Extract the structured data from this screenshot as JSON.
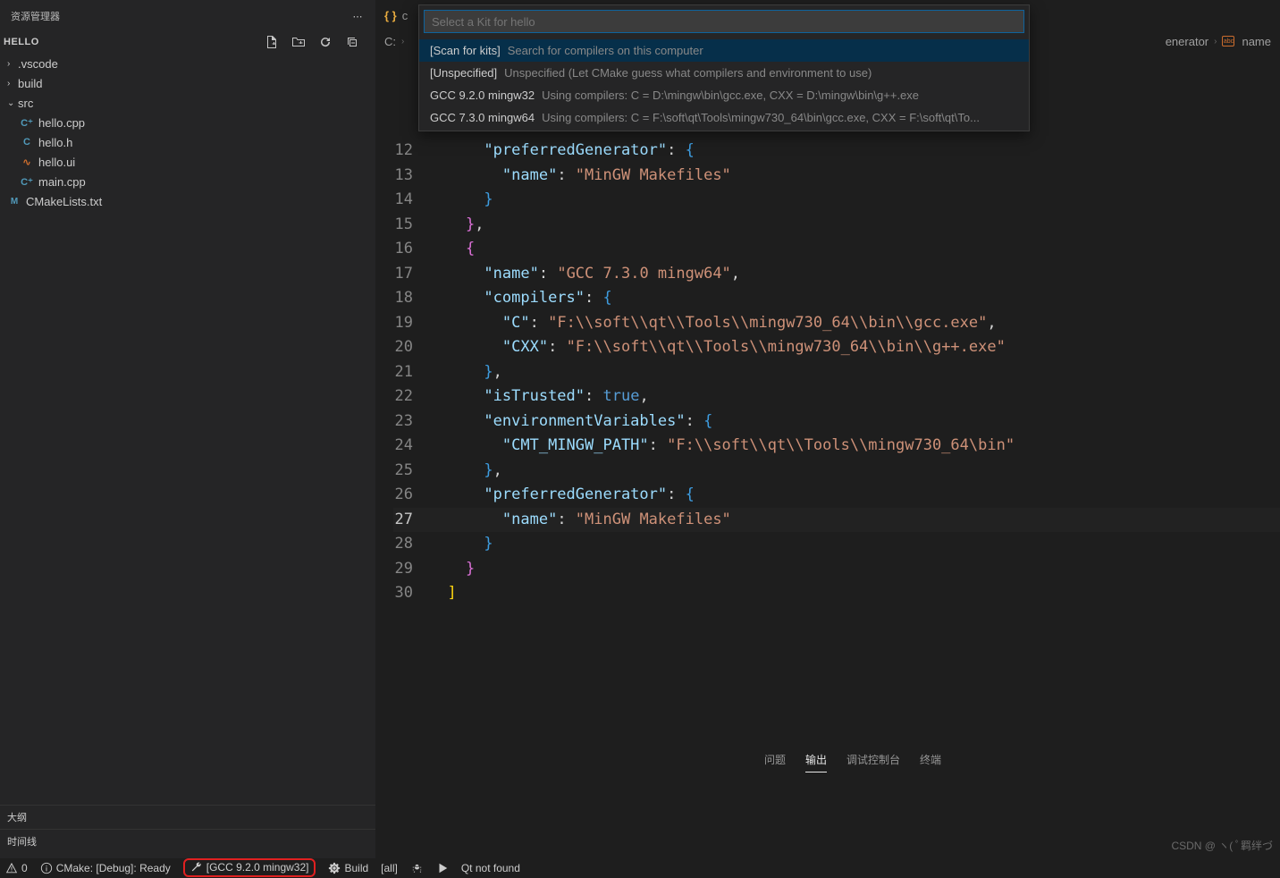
{
  "sidebar": {
    "title": "资源管理器",
    "projectName": "HELLO",
    "tree": {
      "folder_vscode": ".vscode",
      "folder_build": "build",
      "folder_src": "src",
      "file_hello_cpp": "hello.cpp",
      "file_hello_h": "hello.h",
      "file_hello_ui": "hello.ui",
      "file_main_cpp": "main.cpp",
      "file_cmakelists": "CMakeLists.txt"
    },
    "outline": "大纲",
    "timeline": "时间线"
  },
  "tab": {
    "icon": "{ }",
    "label": "c"
  },
  "breadcrumb": {
    "root": "C:",
    "right1": "enerator",
    "right2": "name"
  },
  "quickpick": {
    "placeholder": "Select a Kit for hello",
    "items": [
      {
        "label": "[Scan for kits]",
        "desc": "Search for compilers on this computer"
      },
      {
        "label": "[Unspecified]",
        "desc": "Unspecified (Let CMake guess what compilers and environment to use)"
      },
      {
        "label": "GCC 9.2.0 mingw32",
        "desc": "Using compilers: C = D:\\mingw\\bin\\gcc.exe, CXX = D:\\mingw\\bin\\g++.exe"
      },
      {
        "label": "GCC 7.3.0 mingw64",
        "desc": "Using compilers: C = F:\\soft\\qt\\Tools\\mingw730_64\\bin\\gcc.exe, CXX = F:\\soft\\qt\\To..."
      }
    ]
  },
  "code": {
    "lines": [
      {
        "n": 12,
        "indent": 3,
        "tokens": [
          [
            "key",
            "\"preferredGenerator\""
          ],
          [
            "punc",
            ": "
          ],
          [
            "brace",
            "{"
          ]
        ]
      },
      {
        "n": 13,
        "indent": 4,
        "tokens": [
          [
            "key",
            "\"name\""
          ],
          [
            "punc",
            ": "
          ],
          [
            "str",
            "\"MinGW Makefiles\""
          ]
        ]
      },
      {
        "n": 14,
        "indent": 3,
        "tokens": [
          [
            "brace",
            "}"
          ]
        ]
      },
      {
        "n": 15,
        "indent": 2,
        "tokens": [
          [
            "brace2",
            "}"
          ],
          [
            "punc",
            ","
          ]
        ]
      },
      {
        "n": 16,
        "indent": 2,
        "tokens": [
          [
            "brace2",
            "{"
          ]
        ]
      },
      {
        "n": 17,
        "indent": 3,
        "tokens": [
          [
            "key",
            "\"name\""
          ],
          [
            "punc",
            ": "
          ],
          [
            "str",
            "\"GCC 7.3.0 mingw64\""
          ],
          [
            "punc",
            ","
          ]
        ]
      },
      {
        "n": 18,
        "indent": 3,
        "tokens": [
          [
            "key",
            "\"compilers\""
          ],
          [
            "punc",
            ": "
          ],
          [
            "brace",
            "{"
          ]
        ]
      },
      {
        "n": 19,
        "indent": 4,
        "tokens": [
          [
            "key",
            "\"C\""
          ],
          [
            "punc",
            ": "
          ],
          [
            "str",
            "\"F:\\\\soft\\\\qt\\\\Tools\\\\mingw730_64\\\\bin\\\\gcc.exe\""
          ],
          [
            "punc",
            ","
          ]
        ]
      },
      {
        "n": 20,
        "indent": 4,
        "tokens": [
          [
            "key",
            "\"CXX\""
          ],
          [
            "punc",
            ": "
          ],
          [
            "str",
            "\"F:\\\\soft\\\\qt\\\\Tools\\\\mingw730_64\\\\bin\\\\g++.exe\""
          ]
        ]
      },
      {
        "n": 21,
        "indent": 3,
        "tokens": [
          [
            "brace",
            "}"
          ],
          [
            "punc",
            ","
          ]
        ]
      },
      {
        "n": 22,
        "indent": 3,
        "tokens": [
          [
            "key",
            "\"isTrusted\""
          ],
          [
            "punc",
            ": "
          ],
          [
            "bool",
            "true"
          ],
          [
            "punc",
            ","
          ]
        ]
      },
      {
        "n": 23,
        "indent": 3,
        "tokens": [
          [
            "key",
            "\"environmentVariables\""
          ],
          [
            "punc",
            ": "
          ],
          [
            "brace",
            "{"
          ]
        ]
      },
      {
        "n": 24,
        "indent": 4,
        "tokens": [
          [
            "key",
            "\"CMT_MINGW_PATH\""
          ],
          [
            "punc",
            ": "
          ],
          [
            "str",
            "\"F:\\\\soft\\\\qt\\\\Tools\\\\mingw730_64\\bin\""
          ]
        ]
      },
      {
        "n": 25,
        "indent": 3,
        "tokens": [
          [
            "brace",
            "}"
          ],
          [
            "punc",
            ","
          ]
        ]
      },
      {
        "n": 26,
        "indent": 3,
        "tokens": [
          [
            "key",
            "\"preferredGenerator\""
          ],
          [
            "punc",
            ": "
          ],
          [
            "brace",
            "{"
          ]
        ]
      },
      {
        "n": 27,
        "indent": 4,
        "current": true,
        "tokens": [
          [
            "key",
            "\"name\""
          ],
          [
            "punc",
            ": "
          ],
          [
            "str",
            "\"MinGW Makefiles\""
          ]
        ]
      },
      {
        "n": 28,
        "indent": 3,
        "tokens": [
          [
            "brace",
            "}"
          ]
        ]
      },
      {
        "n": 29,
        "indent": 2,
        "tokens": [
          [
            "brace2",
            "}"
          ]
        ]
      },
      {
        "n": 30,
        "indent": 1,
        "tokens": [
          [
            "brace3",
            "]"
          ]
        ]
      }
    ]
  },
  "terminal": {
    "tabs": {
      "problems": "问题",
      "output": "输出",
      "debug": "调试控制台",
      "terminal": "终端"
    }
  },
  "statusbar": {
    "warnings": "0",
    "cmake": "CMake: [Debug]: Ready",
    "kit": "[GCC 9.2.0 mingw32]",
    "build": "Build",
    "target": "[all]",
    "qt": "Qt not found"
  },
  "watermark": "CSDN @ ヽ( ﾟ羁绊づ"
}
